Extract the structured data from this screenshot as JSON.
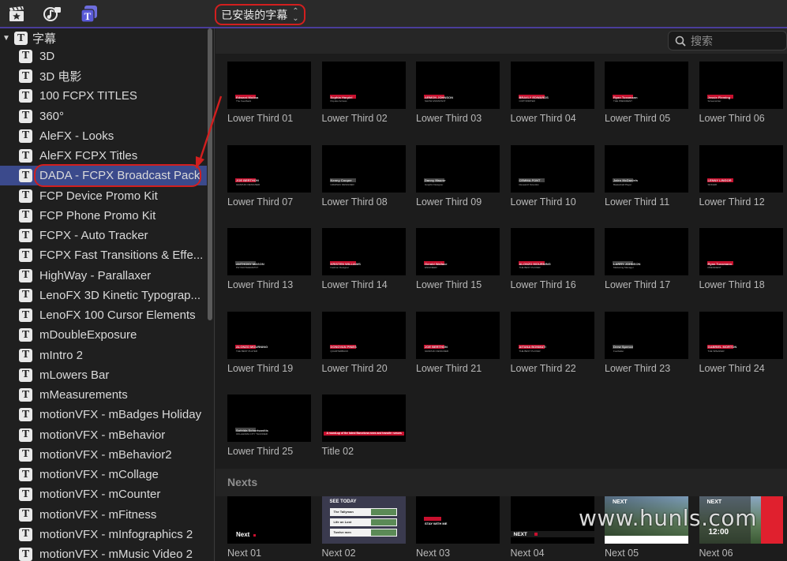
{
  "toolbar": {
    "icons": [
      "clapper-star-icon",
      "music-camera-icon",
      "titles-icon"
    ],
    "selector_label": "已安装的字幕"
  },
  "sidebar": {
    "root_label": "字幕",
    "items": [
      {
        "label": "3D"
      },
      {
        "label": "3D 电影"
      },
      {
        "label": "100 FCPX TITLES"
      },
      {
        "label": "360°"
      },
      {
        "label": "AleFX - Looks"
      },
      {
        "label": "AleFX FCPX Titles"
      },
      {
        "label": "DADA - FCPX Broadcast Pack",
        "selected": true
      },
      {
        "label": "FCP Device Promo Kit"
      },
      {
        "label": "FCP Phone Promo Kit"
      },
      {
        "label": "FCPX - Auto Tracker"
      },
      {
        "label": "FCPX Fast Transitions & Effe..."
      },
      {
        "label": "HighWay - Parallaxer"
      },
      {
        "label": "LenoFX 3D Kinetic Typograp..."
      },
      {
        "label": "LenoFX 100 Cursor Elements"
      },
      {
        "label": "mDoubleExposure"
      },
      {
        "label": "mIntro 2"
      },
      {
        "label": "mLowers Bar"
      },
      {
        "label": "mMeasurements"
      },
      {
        "label": "motionVFX - mBadges Holiday"
      },
      {
        "label": "motionVFX - mBehavior"
      },
      {
        "label": "motionVFX - mBehavior2"
      },
      {
        "label": "motionVFX - mCollage"
      },
      {
        "label": "motionVFX - mCounter"
      },
      {
        "label": "motionVFX - mFitness"
      },
      {
        "label": "motionVFX - mInfographics 2"
      },
      {
        "label": "motionVFX - mMusic Video 2"
      }
    ]
  },
  "search": {
    "placeholder": "搜索"
  },
  "titles": [
    {
      "label": "Lower Third 01",
      "name": "Edward Molina",
      "role": "The Feedback",
      "accent": "#c8102e"
    },
    {
      "label": "Lower Third 02",
      "name": "Sophia Harpiel",
      "role": "Popular Actress",
      "accent": "#c8102e"
    },
    {
      "label": "Lower Third 03",
      "name": "ARMON JOHNSON",
      "role": "SHOW ASSISTANT",
      "accent": "#c8102e"
    },
    {
      "label": "Lower Third 04",
      "name": "BRAVLY EDWARDS",
      "role": "COPYWRITER",
      "accent": "#c8102e"
    },
    {
      "label": "Lower Third 05",
      "name": "Ryan Tussmann",
      "role": "THE PRESIDENT",
      "accent": "#c8102e"
    },
    {
      "label": "Lower Third 06",
      "name": "Jessie Fleming",
      "role": "Screenwriter",
      "accent": "#c8102e"
    },
    {
      "label": "Lower Third 07",
      "name": "JOE BERTHON",
      "role": "GRAPHIC DESIGNER",
      "accent": "#c8102e"
    },
    {
      "label": "Lower Third 08",
      "name": "Kenny Cooper",
      "role": "GRAPHIC DESIGNER",
      "accent": "#444444"
    },
    {
      "label": "Lower Third 09",
      "name": "Danny Maurer",
      "role": "Graphic Designer",
      "accent": "#444444"
    },
    {
      "label": "Lower Third 10",
      "name": "CEMMA FONT",
      "role": "Research Scientist",
      "accent": "#444444"
    },
    {
      "label": "Lower Third 11",
      "name": "Jalen McDaniels",
      "role": "Basketball Player",
      "accent": "#444444"
    },
    {
      "label": "Lower Third 12",
      "name": "LENNY LINGOR",
      "role": "SINGER",
      "accent": "#c8102e"
    },
    {
      "label": "Lower Third 13",
      "name": "ANTHONY MASON",
      "role": "PHYSIOTHERAPIST",
      "accent": "#444444"
    },
    {
      "label": "Lower Third 14",
      "name": "KRISTEN WILLIAMS",
      "role": "Fashion Designer",
      "accent": "#c8102e"
    },
    {
      "label": "Lower Third 15",
      "name": "Gerald Wallace",
      "role": "ENGINEER",
      "accent": "#c8102e"
    },
    {
      "label": "Lower Third 16",
      "name": "ALONZO MOURNING",
      "role": "THE BEST PLAYER",
      "accent": "#c8102e"
    },
    {
      "label": "Lower Third 17",
      "name": "LARRY JOHNSON",
      "role": "Marketing Manager",
      "accent": "#444444"
    },
    {
      "label": "Lower Third 18",
      "name": "Ryan Tussmann",
      "role": "PRESIDENT",
      "accent": "#c8102e"
    },
    {
      "label": "Lower Third 19",
      "name": "ALONZO MOURNING",
      "role": "THE BEST PLAYER",
      "accent": "#c8102e"
    },
    {
      "label": "Lower Third 20",
      "name": "DONOVAN PINES",
      "role": "QUARTERBACK",
      "accent": "#c8102e"
    },
    {
      "label": "Lower Third 21",
      "name": "JOE BERTHON",
      "role": "GRAPHIC DESIGNER",
      "accent": "#c8102e"
    },
    {
      "label": "Lower Third 22",
      "name": "AITANA BONMATI",
      "role": "THE BEST PLAYER",
      "accent": "#c8102e"
    },
    {
      "label": "Lower Third 23",
      "name": "Drew Spence",
      "role": "Footballer",
      "accent": "#444444"
    },
    {
      "label": "Lower Third 24",
      "name": "GABRIEL MORTON",
      "role": "THE SPEAKER",
      "accent": "#c8102e"
    },
    {
      "label": "Lower Third 25",
      "name": "Sofelda Schortsanitis",
      "role": "OKLAHOMA CITY THUNDER",
      "accent": "#444444"
    },
    {
      "label": "Title 02",
      "name": "A round-up of the latest Barcelona news and transfer rumors",
      "role": "",
      "accent": "#c8102e"
    }
  ],
  "nexts_header": "Nexts",
  "nexts": [
    {
      "label": "Next 01",
      "text": "Next"
    },
    {
      "label": "Next 02",
      "text": "SEE TODAY",
      "rows": [
        "The Tallyman",
        "Life on Lost",
        "Twelve men"
      ]
    },
    {
      "label": "Next 03",
      "text": "STAY WITH ME"
    },
    {
      "label": "Next 04",
      "text": "NEXT"
    },
    {
      "label": "Next 05",
      "text": "NEXT"
    },
    {
      "label": "Next 06",
      "text": "NEXT",
      "time": "12:00"
    }
  ],
  "watermark": "www.hunls.com"
}
